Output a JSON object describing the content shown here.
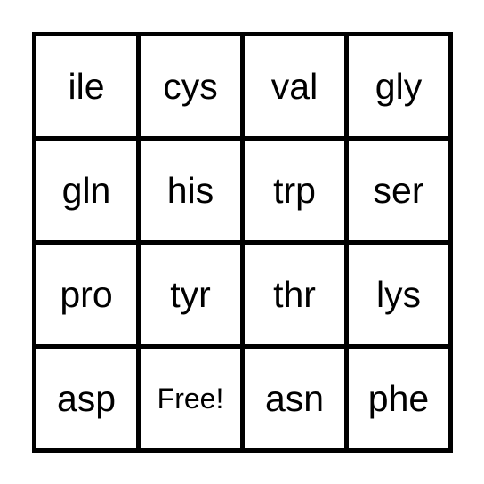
{
  "card": {
    "rows": [
      [
        "ile",
        "cys",
        "val",
        "gly"
      ],
      [
        "gln",
        "his",
        "trp",
        "ser"
      ],
      [
        "pro",
        "tyr",
        "thr",
        "lys"
      ],
      [
        "asp",
        "Free!",
        "asn",
        "phe"
      ]
    ]
  }
}
